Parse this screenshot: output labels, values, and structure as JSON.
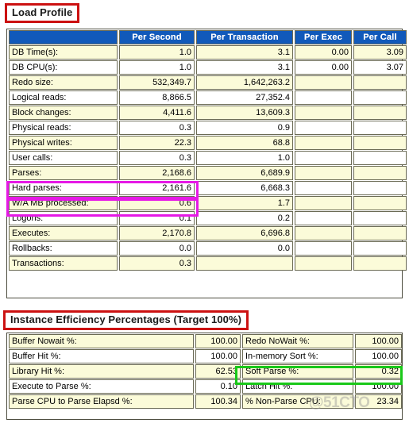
{
  "colors": {
    "header_blue": "#1159ba",
    "row_shade": "#fbfbd9",
    "title_outline_red": "#cc1111",
    "highlight_magenta": "#e619e6",
    "highlight_green": "#19c819"
  },
  "load_profile": {
    "title": "Load Profile",
    "columns": [
      "",
      "Per Second",
      "Per Transaction",
      "Per Exec",
      "Per Call"
    ],
    "rows": [
      {
        "label": "DB Time(s):",
        "per_second": "1.0",
        "per_transaction": "3.1",
        "per_exec": "0.00",
        "per_call": "3.09"
      },
      {
        "label": "DB CPU(s):",
        "per_second": "1.0",
        "per_transaction": "3.1",
        "per_exec": "0.00",
        "per_call": "3.07"
      },
      {
        "label": "Redo size:",
        "per_second": "532,349.7",
        "per_transaction": "1,642,263.2",
        "per_exec": "",
        "per_call": ""
      },
      {
        "label": "Logical reads:",
        "per_second": "8,866.5",
        "per_transaction": "27,352.4",
        "per_exec": "",
        "per_call": ""
      },
      {
        "label": "Block changes:",
        "per_second": "4,411.6",
        "per_transaction": "13,609.3",
        "per_exec": "",
        "per_call": ""
      },
      {
        "label": "Physical reads:",
        "per_second": "0.3",
        "per_transaction": "0.9",
        "per_exec": "",
        "per_call": ""
      },
      {
        "label": "Physical writes:",
        "per_second": "22.3",
        "per_transaction": "68.8",
        "per_exec": "",
        "per_call": ""
      },
      {
        "label": "User calls:",
        "per_second": "0.3",
        "per_transaction": "1.0",
        "per_exec": "",
        "per_call": ""
      },
      {
        "label": "Parses:",
        "per_second": "2,168.6",
        "per_transaction": "6,689.9",
        "per_exec": "",
        "per_call": ""
      },
      {
        "label": "Hard parses:",
        "per_second": "2,161.6",
        "per_transaction": "6,668.3",
        "per_exec": "",
        "per_call": ""
      },
      {
        "label": "W/A MB processed:",
        "per_second": "0.6",
        "per_transaction": "1.7",
        "per_exec": "",
        "per_call": ""
      },
      {
        "label": "Logons:",
        "per_second": "0.1",
        "per_transaction": "0.2",
        "per_exec": "",
        "per_call": ""
      },
      {
        "label": "Executes:",
        "per_second": "2,170.8",
        "per_transaction": "6,696.8",
        "per_exec": "",
        "per_call": ""
      },
      {
        "label": "Rollbacks:",
        "per_second": "0.0",
        "per_transaction": "0.0",
        "per_exec": "",
        "per_call": ""
      },
      {
        "label": "Transactions:",
        "per_second": "0.3",
        "per_transaction": "",
        "per_exec": "",
        "per_call": ""
      }
    ]
  },
  "instance_efficiency": {
    "title": "Instance Efficiency Percentages (Target 100%)",
    "rows": [
      {
        "label_a": "Buffer Nowait %:",
        "value_a": "100.00",
        "label_b": "Redo NoWait %:",
        "value_b": "100.00"
      },
      {
        "label_a": "Buffer Hit %:",
        "value_a": "100.00",
        "label_b": "In-memory Sort %:",
        "value_b": "100.00"
      },
      {
        "label_a": "Library Hit %:",
        "value_a": "62.53",
        "label_b": "Soft Parse %:",
        "value_b": "0.32"
      },
      {
        "label_a": "Execute to Parse %:",
        "value_a": "0.10",
        "label_b": "Latch Hit %:",
        "value_b": "100.00"
      },
      {
        "label_a": "Parse CPU to Parse Elapsd %:",
        "value_a": "100.34",
        "label_b": "% Non-Parse CPU:",
        "value_b": "23.34"
      }
    ]
  },
  "annotations": {
    "parses_highlight": "Parses",
    "hard_parses_highlight": "Hard parses",
    "soft_parse_highlight": "Soft Parse %"
  },
  "watermark": {
    "text": "@51CTO"
  }
}
